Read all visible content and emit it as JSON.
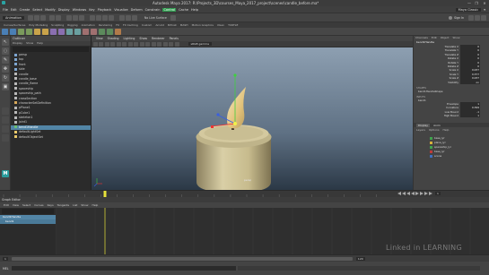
{
  "window": {
    "title": "Autodesk Maya 2017: R:\\Projects_3D\\courses_Maya_2017_project\\scenes\\candle_before.ma*",
    "controls": [
      "—",
      "❐",
      "✕"
    ]
  },
  "menubar": {
    "items": [
      "File",
      "Edit",
      "Create",
      "Select",
      "Modify",
      "Display",
      "Windows",
      "Key",
      "Playback",
      "Visualize",
      "Deform",
      "Constrain",
      "Control",
      "Cache",
      "Help"
    ],
    "highlighted": [
      "Control"
    ],
    "mode_menu": "Animation",
    "workspace": "Maya Classic"
  },
  "statusline": {
    "no_live_surface": "No Live Surface",
    "sign_in": "Sign In"
  },
  "shelf": {
    "tabs": [
      "Curves/Surfaces",
      "Poly Modeling",
      "Sculpting",
      "Rigging",
      "Animation",
      "Rendering",
      "FX",
      "FX Caching",
      "Custom",
      "Arnold",
      "Bifrost",
      "MASH",
      "Motion Graphics",
      "XGen",
      "TURTLE"
    ]
  },
  "toolbox": {
    "tools": [
      "select-tool",
      "lasso-tool",
      "paint-select-tool",
      "move-tool",
      "rotate-tool",
      "scale-tool"
    ]
  },
  "outliner": {
    "title": "Outliner",
    "menu": [
      "Display",
      "Show",
      "Help"
    ],
    "items": [
      {
        "label": "persp",
        "color": "#7ea6d1"
      },
      {
        "label": "top",
        "color": "#7ea6d1"
      },
      {
        "label": "front",
        "color": "#7ea6d1"
      },
      {
        "label": "side",
        "color": "#7ea6d1"
      },
      {
        "label": "candle",
        "color": "#b9b9b9"
      },
      {
        "label": "candle_base",
        "color": "#b9b9b9"
      },
      {
        "label": "candle_flame",
        "color": "#b9b9b9"
      },
      {
        "label": "spaceship",
        "color": "#b9b9b9"
      },
      {
        "label": "spaceship_path",
        "color": "#b9b9b9"
      },
      {
        "label": "crossSection",
        "color": "#b9b9b9"
      },
      {
        "label": "characterSetDefinition",
        "color": "#d6a85a"
      },
      {
        "label": "pPlane1",
        "color": "#b9b9b9"
      },
      {
        "label": "pCube1",
        "color": "#b9b9b9"
      },
      {
        "label": "skeleton1",
        "color": "#b9b9b9"
      },
      {
        "label": "joint1",
        "color": "#b9b9b9"
      },
      {
        "label": "bend1Handle",
        "color": "#6fbf73"
      },
      {
        "label": "defaultLightSet",
        "color": "#e8c96a"
      },
      {
        "label": "defaultObjectSet",
        "color": "#e8c96a"
      }
    ],
    "selected_index": 15
  },
  "viewport": {
    "menu": [
      "View",
      "Shading",
      "Lighting",
      "Show",
      "Renderer",
      "Panels"
    ],
    "camera_label": "persp",
    "colorspace": "sRGB gamma"
  },
  "channelbox": {
    "tabs": [
      "Channels",
      "Edit",
      "Object",
      "Show"
    ],
    "object_name": "bend1Handle",
    "attributes": [
      {
        "name": "Translate X",
        "value": "0"
      },
      {
        "name": "Translate Y",
        "value": "0"
      },
      {
        "name": "Translate Z",
        "value": "0"
      },
      {
        "name": "Rotate X",
        "value": "0"
      },
      {
        "name": "Rotate Y",
        "value": "0"
      },
      {
        "name": "Rotate Z",
        "value": "0"
      },
      {
        "name": "Scale X",
        "value": "0.037"
      },
      {
        "name": "Scale Y",
        "value": "0.377"
      },
      {
        "name": "Scale Z",
        "value": "0.037"
      },
      {
        "name": "Visibility",
        "value": "on"
      }
    ],
    "shapes_label": "SHAPES",
    "shape_name": "bend1HandleShape",
    "inputs_label": "INPUTS",
    "input_name": "bend1",
    "deform_attrs": [
      {
        "name": "Envelope",
        "value": "1"
      },
      {
        "name": "Curvature",
        "value": "0.399"
      },
      {
        "name": "Low Bound",
        "value": "-1"
      },
      {
        "name": "High Bound",
        "value": "1"
      }
    ],
    "layer_tabs": [
      "Display",
      "Anim"
    ],
    "layer_menu": [
      "Layers",
      "Options",
      "Help"
    ],
    "layers": [
      {
        "label": "base_lyr",
        "color": "#3fa34d"
      },
      {
        "label": "plane_lyr",
        "color": "#d6b03c"
      },
      {
        "label": "spaceship_lyr",
        "color": "#3fa34d"
      },
      {
        "label": "base_lyr",
        "color": "#c03a3a"
      },
      {
        "label": "scene",
        "color": "#3f6fbf"
      }
    ]
  },
  "timeslider": {
    "current_frame": "1",
    "end_frame": "120"
  },
  "grapheditor": {
    "title": "Graph Editor",
    "menu": [
      "Edit",
      "View",
      "Select",
      "Curves",
      "Keys",
      "Tangents",
      "List",
      "Show",
      "Help"
    ],
    "items": [
      "bend1Handle",
      "bend1"
    ]
  },
  "range": {
    "start": "1",
    "end": "120"
  },
  "helpline": {
    "mel_label": "MEL"
  },
  "watermark": "Linked in LEARNING",
  "colors": {
    "accent_green": "#2e9b4e",
    "selection_blue": "#5285a6",
    "timeline_marker": "#e7e23a"
  }
}
